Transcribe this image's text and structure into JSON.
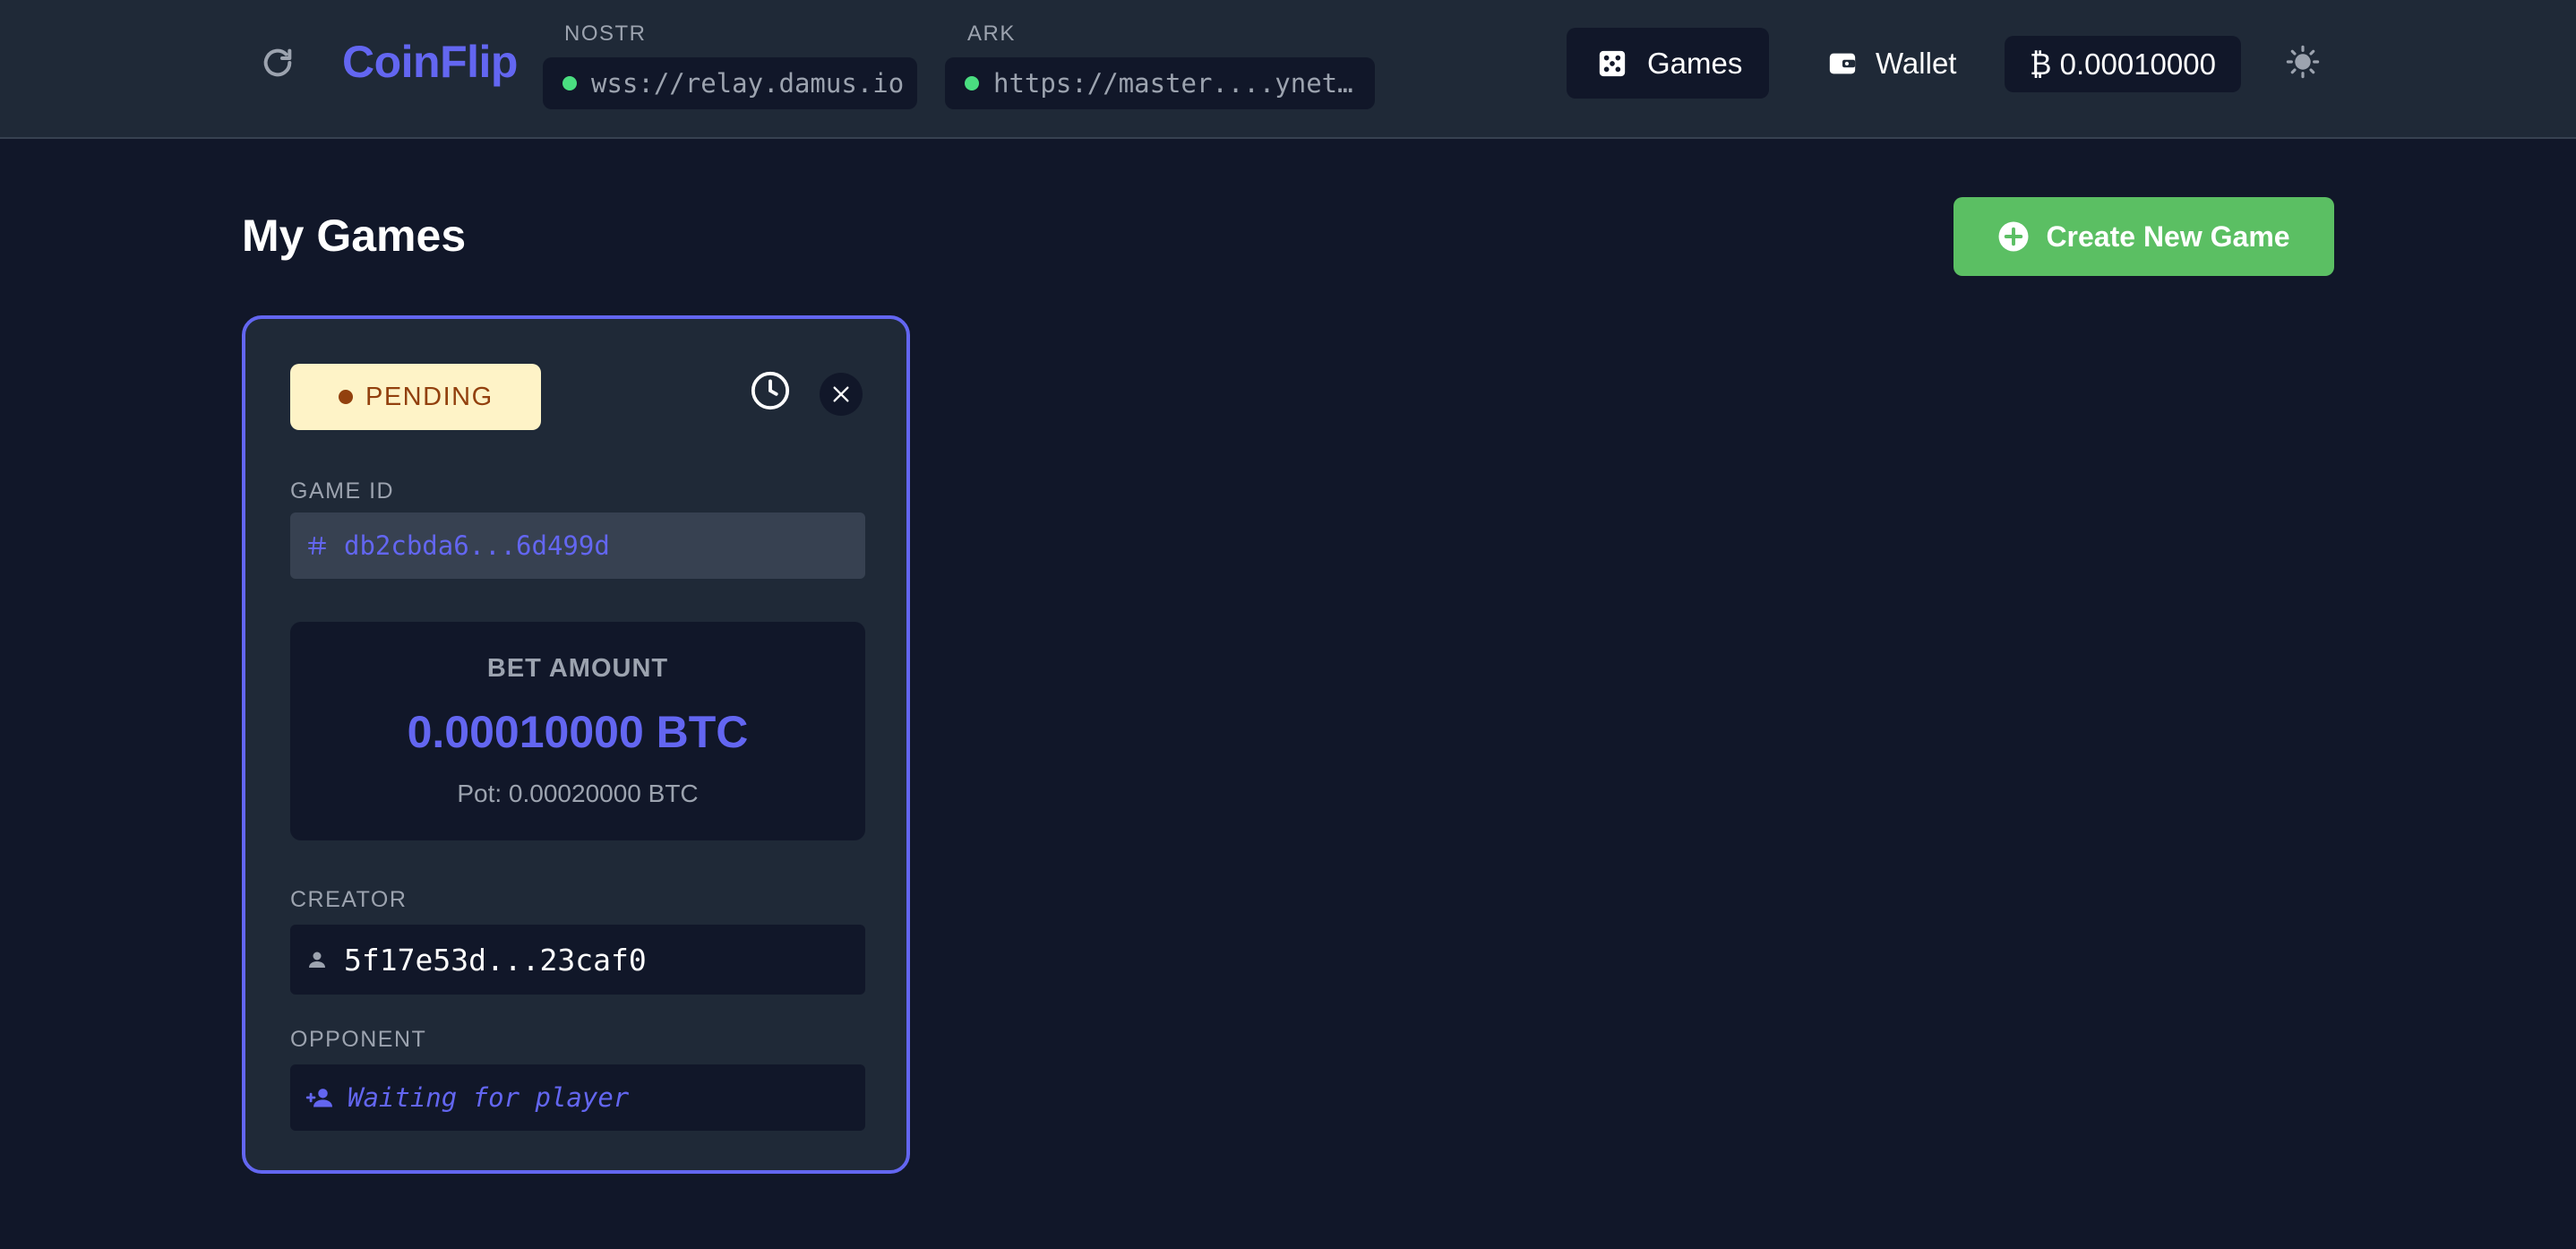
{
  "header": {
    "app_name": "CoinFlip",
    "nostr": {
      "label": "NOSTR",
      "url": "wss://relay.damus.io",
      "status_color": "#4ade80"
    },
    "ark": {
      "label": "ARK",
      "url": "https://master....ynet…",
      "status_color": "#4ade80"
    },
    "nav": {
      "games_label": "Games",
      "wallet_label": "Wallet"
    },
    "balance": "₿ 0.00010000"
  },
  "main": {
    "title": "My Games",
    "create_button_label": "Create New Game"
  },
  "game_card": {
    "status": "PENDING",
    "game_id_label": "GAME ID",
    "game_id": "db2cbda6...6d499d",
    "bet_label": "BET AMOUNT",
    "bet_amount": "0.00010000 BTC",
    "pot": "Pot: 0.00020000 BTC",
    "creator_label": "CREATOR",
    "creator": "5f17e53d...23caf0",
    "opponent_label": "OPPONENT",
    "opponent": "Waiting for player"
  },
  "colors": {
    "accent": "#6366f1",
    "success": "#5bbf63",
    "pending_bg": "#fef3c7",
    "pending_text": "#92400e",
    "background": "#111729",
    "surface": "#1f2937"
  },
  "icons": {
    "refresh": "refresh-icon",
    "games": "dice-icon",
    "wallet": "wallet-icon",
    "theme": "sun-icon",
    "create": "plus-circle-icon",
    "history": "clock-icon",
    "close": "close-icon",
    "game_id": "hash-icon",
    "creator": "person-icon",
    "opponent": "person-add-icon"
  }
}
